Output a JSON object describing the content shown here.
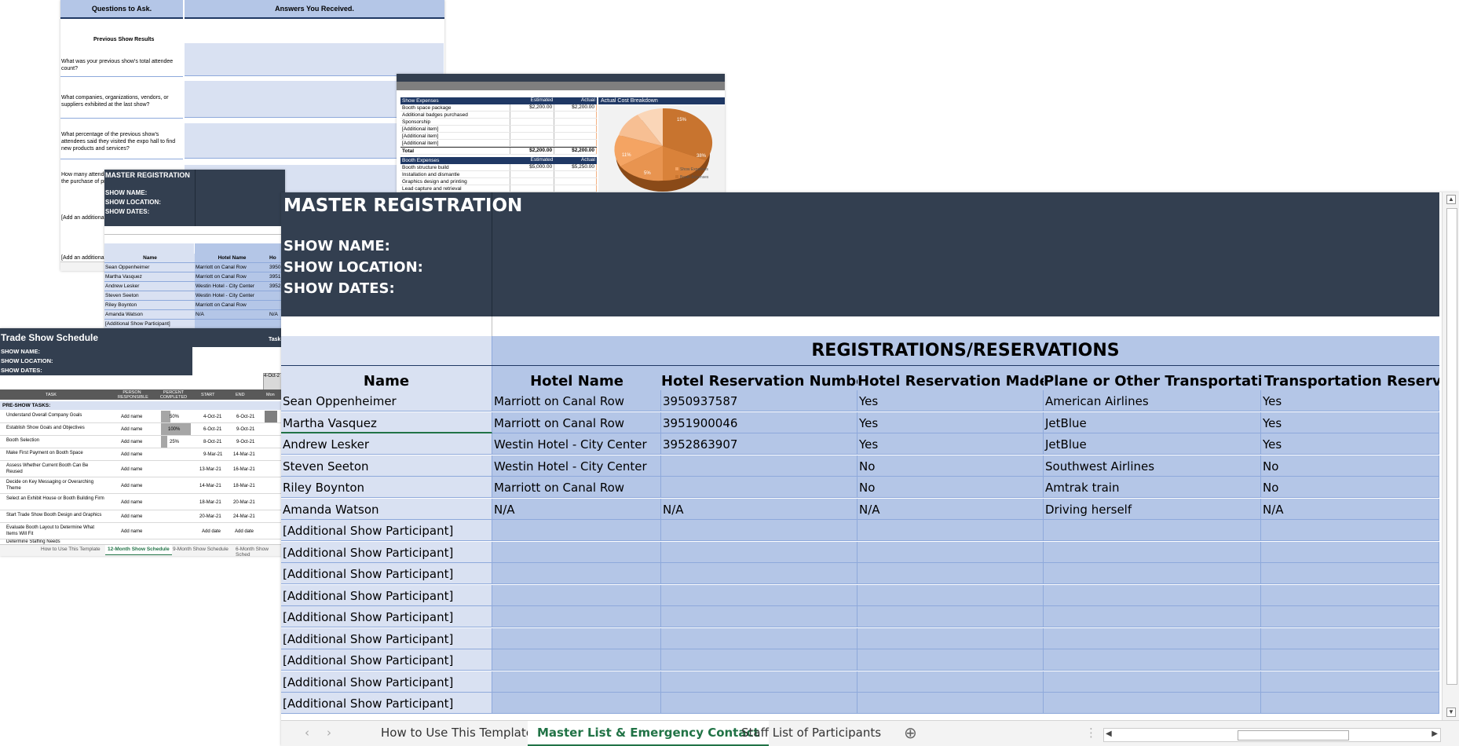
{
  "questionnaire": {
    "col_questions": "Questions to Ask.",
    "col_answers": "Answers You Received.",
    "section": "Previous Show Results",
    "questions": [
      "What was your previous show's total attendee count?",
      "What companies, organizations, vendors, or suppliers exhibited at the last show?",
      "What percentage of the previous show's attendees said they visited the expo hall to find new products and services?",
      "How many attendees said the show influenced the purchase of products or services?",
      "[Add an additional question here or industry.]",
      "[Add an additional"
    ]
  },
  "expenses": {
    "show_header": [
      "Show Expenses",
      "Estimated",
      "Actual"
    ],
    "show_rows": [
      [
        "Booth space package",
        "$2,200.00",
        "$2,200.00"
      ],
      [
        "Additional badges purchased",
        "",
        ""
      ],
      [
        "Sponsorship",
        "",
        ""
      ],
      [
        "[Additional item]",
        "",
        ""
      ],
      [
        "[Additional item]",
        "",
        ""
      ],
      [
        "[Additional item]",
        "",
        ""
      ]
    ],
    "show_total": [
      "Total",
      "$2,200.00",
      "$2,200.00"
    ],
    "booth_header": [
      "Booth Expenses",
      "Estimated",
      "Actual"
    ],
    "booth_rows": [
      [
        "Booth structure build",
        "$5,000.00",
        "$5,250.00"
      ],
      [
        "Installation and dismantle",
        "",
        ""
      ],
      [
        "Graphics design and printing",
        "",
        ""
      ],
      [
        "Lead capture and retrieval",
        "",
        ""
      ]
    ],
    "chart_title": "Actual Cost Breakdown",
    "legend": [
      "Show Expenses",
      "Booth Expenses"
    ],
    "slice_labels": [
      "15%",
      "38%",
      "11%",
      "5%"
    ]
  },
  "master_small": {
    "title": "MASTER REGISTRATION",
    "show_name": "SHOW NAME:",
    "show_location": "SHOW LOCATION:",
    "show_dates": "SHOW DATES:",
    "col_name": "Name",
    "col_hotel": "Hotel Name",
    "col_ho": "Ho",
    "rows": [
      [
        "Sean Oppenheimer",
        "Marriott on Canal Row",
        "3950"
      ],
      [
        "Martha Vasquez",
        "Marriott on Canal Row",
        "3951"
      ],
      [
        "Andrew Lesker",
        "Westin Hotel - City Center",
        "3952"
      ],
      [
        "Steven Seeton",
        "Westin Hotel - City Center",
        ""
      ],
      [
        "Riley Boynton",
        "Marriott on Canal Row",
        ""
      ],
      [
        "Amanda Watson",
        "N/A",
        "N/A"
      ],
      [
        "[Additional Show Participant]",
        "",
        ""
      ]
    ]
  },
  "schedule": {
    "title": "Trade Show Schedule",
    "task_label": "Task",
    "show_name": "SHOW NAME:",
    "show_location": "SHOW LOCATION:",
    "show_dates": "SHOW DATES:",
    "date_box": "4-Oct-2",
    "cols": [
      "TASK",
      "PERSON RESPONSIBLE",
      "PERCENT COMPLETED",
      "START",
      "END",
      "Mon"
    ],
    "pre_show": "PRE-SHOW TASKS:",
    "rows": [
      [
        "Understand Overall Company Goals",
        "Add name",
        "50%",
        "4-Oct-21",
        "6-Oct-21"
      ],
      [
        "Establish Show Goals and Objectives",
        "Add name",
        "100%",
        "6-Oct-21",
        "9-Oct-21"
      ],
      [
        "Booth Selection",
        "Add name",
        "25%",
        "8-Oct-21",
        "9-Oct-21"
      ],
      [
        "Make First Payment on Booth Space",
        "Add name",
        "",
        "9-Mar-21",
        "14-Mar-21"
      ],
      [
        "Assess Whether Current Booth Can Be Reused",
        "Add name",
        "",
        "13-Mar-21",
        "16-Mar-21"
      ],
      [
        "Decide on Key Messaging or Overarching Theme",
        "Add name",
        "",
        "14-Mar-21",
        "18-Mar-21"
      ],
      [
        "Select an Exhibit House or Booth Building Firm",
        "Add name",
        "",
        "18-Mar-21",
        "20-Mar-21"
      ],
      [
        "Start Trade Show Booth Design and Graphics",
        "Add name",
        "",
        "20-Mar-21",
        "24-Mar-21"
      ],
      [
        "Evaluate Booth Layout to Determine What Items Will Fit",
        "Add name",
        "",
        "Add date",
        "Add date"
      ],
      [
        "Determine Staffing Needs",
        "",
        "",
        "",
        ""
      ]
    ],
    "tabs": [
      "How to Use This Template",
      "12-Month Show Schedule",
      "9-Month Show Schedule",
      "6-Month Show Sched"
    ]
  },
  "main": {
    "title": "MASTER REGISTRATION",
    "show_name": "SHOW NAME:",
    "show_location": "SHOW LOCATION:",
    "show_dates": "SHOW DATES:",
    "band_title": "REGISTRATIONS/RESERVATIONS",
    "columns": [
      "Name",
      "Hotel Name",
      "Hotel Reservation Number",
      "Hotel Reservation Made?",
      "Plane or Other Transportation",
      "Transportation Reservat"
    ],
    "rows": [
      [
        "Sean Oppenheimer",
        "Marriott on Canal Row",
        "3950937587",
        "Yes",
        "American Airlines",
        "Yes"
      ],
      [
        "Martha Vasquez",
        "Marriott on Canal Row",
        "3951900046",
        "Yes",
        "JetBlue",
        "Yes"
      ],
      [
        "Andrew Lesker",
        "Westin Hotel - City Center",
        "3952863907",
        "Yes",
        "JetBlue",
        "Yes"
      ],
      [
        "Steven Seeton",
        "Westin Hotel - City Center",
        "",
        "No",
        "Southwest Airlines",
        "No"
      ],
      [
        "Riley Boynton",
        "Marriott on Canal Row",
        "",
        "No",
        "Amtrak train",
        "No"
      ],
      [
        "Amanda Watson",
        "N/A",
        "N/A",
        "N/A",
        "Driving herself",
        "N/A"
      ],
      [
        "[Additional Show Participant]",
        "",
        "",
        "",
        "",
        ""
      ],
      [
        "[Additional Show Participant]",
        "",
        "",
        "",
        "",
        ""
      ],
      [
        "[Additional Show Participant]",
        "",
        "",
        "",
        "",
        ""
      ],
      [
        "[Additional Show Participant]",
        "",
        "",
        "",
        "",
        ""
      ],
      [
        "[Additional Show Participant]",
        "",
        "",
        "",
        "",
        ""
      ],
      [
        "[Additional Show Participant]",
        "",
        "",
        "",
        "",
        ""
      ],
      [
        "[Additional Show Participant]",
        "",
        "",
        "",
        "",
        ""
      ],
      [
        "[Additional Show Participant]",
        "",
        "",
        "",
        "",
        ""
      ],
      [
        "[Additional Show Participant]",
        "",
        "",
        "",
        "",
        ""
      ]
    ],
    "tabs": {
      "nav_prev": "‹",
      "nav_next": "›",
      "tab1": "How to Use This Template",
      "tab2": "Master List & Emergency Contact",
      "tab3": "Staff List of Participants",
      "add": "⊕",
      "more": "⋮"
    },
    "colors": {
      "header": "#333f50",
      "band": "#b4c6e7",
      "name_col": "#d9e1f2",
      "tab_active": "#217346"
    }
  }
}
